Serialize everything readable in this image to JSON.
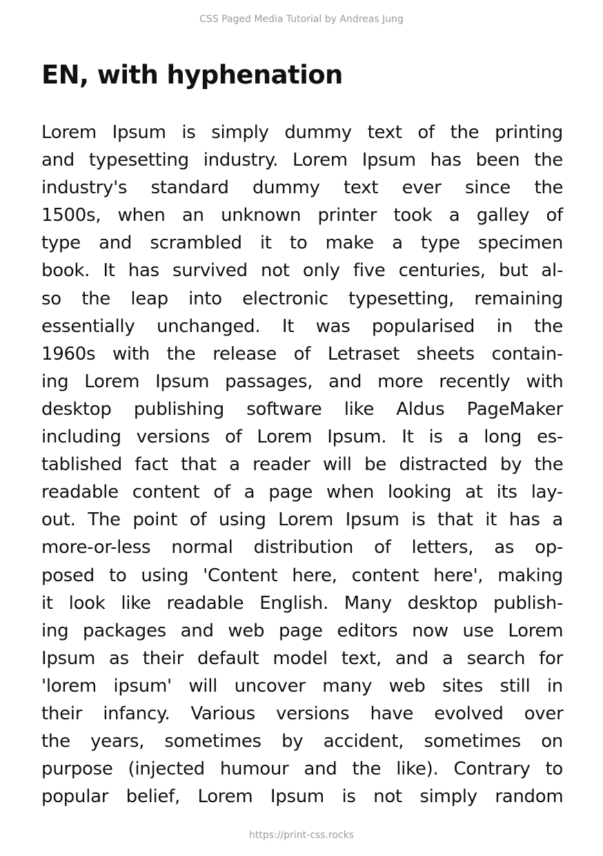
{
  "header": {
    "text": "CSS Paged Media Tutorial by Andreas Jung"
  },
  "title": "EN, with hyphenation",
  "body_lines": [
    "Lorem Ipsum is simply dummy text of the printing",
    "and typesetting industry. Lorem Ipsum has been the",
    "industry's standard dummy text ever since the",
    "1500s, when an unknown printer took a galley of",
    "type and scrambled it to make a type specimen",
    "book. It has survived not only five centuries, but al-",
    "so the leap into electronic typesetting, remaining",
    "essentially unchanged. It was popularised in the",
    "1960s with the release of Letraset sheets contain-",
    "ing Lorem Ipsum passages, and more recently with",
    "desktop publishing software like Aldus PageMaker",
    "including versions of Lorem Ipsum. It is a long es-",
    "tablished fact that a reader will be distracted by the",
    "readable content of a page when looking at its lay-",
    "out. The point of using Lorem Ipsum is that it has a",
    "more-or-less normal distribution of letters, as op-",
    "posed to using 'Content here, content here', making",
    "it look like readable English. Many desktop publish-",
    "ing packages and web page editors now use Lorem",
    "Ipsum as their default model text, and a search for",
    "'lorem ipsum' will uncover many web sites still in",
    "their infancy. Various versions have evolved over",
    "the years, sometimes by accident, sometimes on",
    "purpose (injected humour and the like). Contrary to",
    "popular belief, Lorem Ipsum is not simply random"
  ],
  "footer": {
    "text": "https://print-css.rocks"
  }
}
